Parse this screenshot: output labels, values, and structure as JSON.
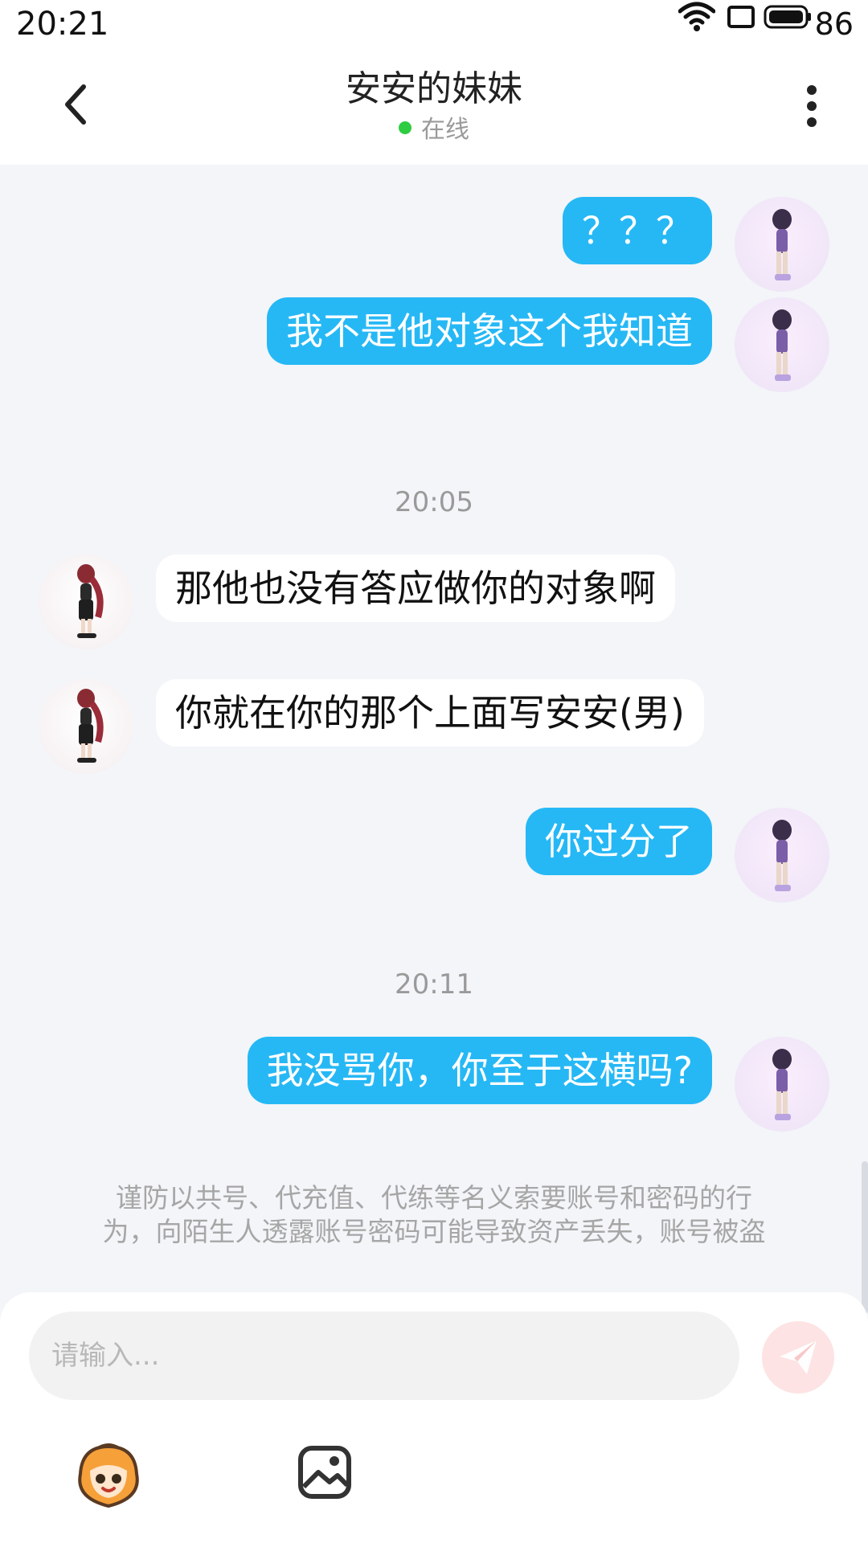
{
  "status_bar": {
    "time": "20:21",
    "battery": "86"
  },
  "header": {
    "title": "安安的妹妹",
    "status": "在线"
  },
  "messages": [
    {
      "side": "me",
      "text": "？？？"
    },
    {
      "side": "me",
      "text": "我不是他对象这个我知道"
    },
    {
      "time": "20:05"
    },
    {
      "side": "them",
      "text": "那他也没有答应做你的对象啊"
    },
    {
      "side": "them",
      "text": "你就在你的那个上面写安安(男)"
    },
    {
      "side": "me",
      "text": "你过分了"
    },
    {
      "time": "20:11"
    },
    {
      "side": "me",
      "text": "我没骂你，你至于这横吗?"
    }
  ],
  "notice": {
    "line1": "谨防以共号、代充值、代练等名义索要账号和密码的行",
    "line2": "为，向陌生人透露账号密码可能导致资产丢失，账号被盗"
  },
  "input": {
    "placeholder": "请输入..."
  },
  "icons": {
    "back": "chevron-left-icon",
    "more": "more-vertical-icon",
    "send": "paper-plane-icon",
    "emoji": "emoji-mascot-icon",
    "image": "image-icon"
  },
  "colors": {
    "my_bubble": "#26b8f5",
    "their_bubble": "#ffffff",
    "online": "#2ecc40",
    "background": "#f3f5f8"
  }
}
